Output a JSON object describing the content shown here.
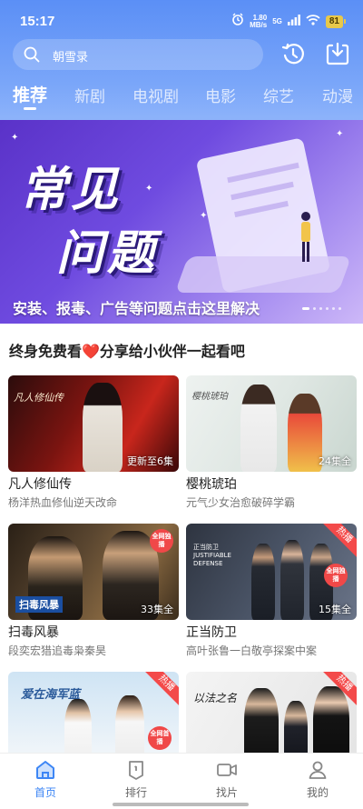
{
  "status_bar": {
    "time": "15:17",
    "speed_value": "1.80",
    "speed_unit": "MB/s",
    "network": "5G",
    "battery": "81"
  },
  "search": {
    "placeholder": "朝雪录"
  },
  "tabs": [
    {
      "label": "推荐",
      "active": true
    },
    {
      "label": "新剧"
    },
    {
      "label": "电视剧"
    },
    {
      "label": "电影"
    },
    {
      "label": "综艺"
    },
    {
      "label": "动漫"
    }
  ],
  "banner": {
    "title_line1": "常见",
    "title_line2": "问题",
    "caption": "安装、报毒、广告等问题点击这里解决"
  },
  "section": {
    "title": "终身免费看❤️分享给小伙伴一起看吧"
  },
  "cards": [
    {
      "title": "凡人修仙传",
      "subtitle": "杨洋热血修仙逆天改命",
      "episodes": "更新至6集",
      "poster_text": "凡人修仙传"
    },
    {
      "title": "樱桃琥珀",
      "subtitle": "元气少女治愈破碎学霸",
      "episodes": "24集全",
      "poster_text": "樱桃琥珀"
    },
    {
      "title": "扫毒风暴",
      "subtitle": "段奕宏猎追毒枭秦昊",
      "episodes": "33集全",
      "poster_text": "扫毒风暴",
      "badge": "全网独播"
    },
    {
      "title": "正当防卫",
      "subtitle": "高叶张鲁一白敬亭探案中案",
      "episodes": "15集全",
      "poster_text": "正当防卫 JUSTIFIABLE DEFENSE",
      "hot": "热播",
      "badge": "全网独播"
    },
    {
      "hot": "热播",
      "badge": "全网首播",
      "poster_text": "爱在海军蓝"
    },
    {
      "hot": "热播",
      "poster_text": "以法之名"
    }
  ],
  "bottom_nav": [
    {
      "label": "首页",
      "icon": "home-icon",
      "active": true
    },
    {
      "label": "排行",
      "icon": "ranking-icon"
    },
    {
      "label": "找片",
      "icon": "video-search-icon"
    },
    {
      "label": "我的",
      "icon": "profile-icon"
    }
  ],
  "colors": {
    "accent": "#3d86f5",
    "header": "#5b8ff6",
    "hot": "#f34a4a"
  }
}
